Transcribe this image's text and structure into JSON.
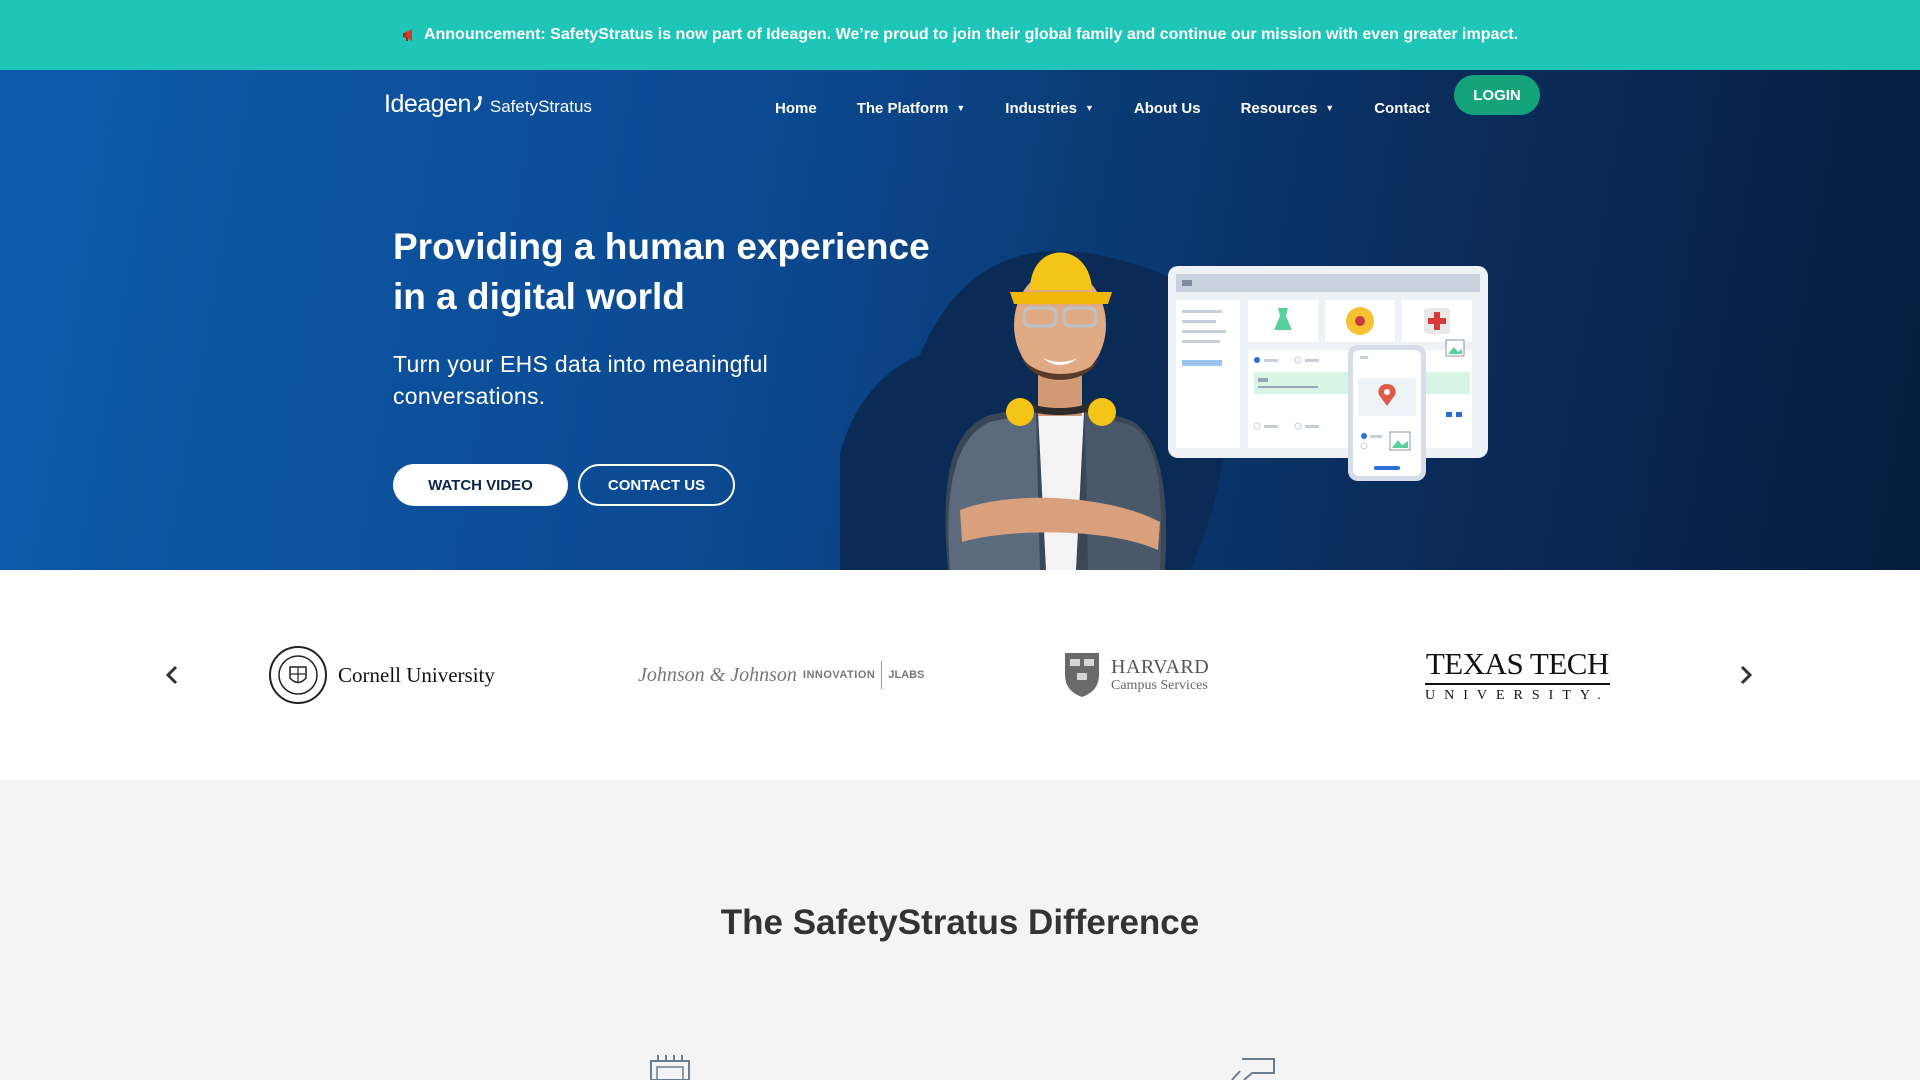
{
  "announcement": {
    "icon": "megaphone-icon",
    "text": "Announcement: SafetyStratus is now part of Ideagen. We’re proud to join their global family and continue our mission with even greater impact."
  },
  "header": {
    "logo_brand": "Ideagen",
    "logo_product": "SafetyStratus",
    "nav": [
      {
        "label": "Home",
        "dropdown": false
      },
      {
        "label": "The Platform",
        "dropdown": true
      },
      {
        "label": "Industries",
        "dropdown": true
      },
      {
        "label": "About Us",
        "dropdown": false
      },
      {
        "label": "Resources",
        "dropdown": true
      },
      {
        "label": "Contact",
        "dropdown": false
      }
    ],
    "login_label": "LOGIN"
  },
  "hero": {
    "title": "Providing a human experience in a digital world",
    "subtitle": "Turn your EHS data into meaningful conversations.",
    "watch_video_label": "WATCH VIDEO",
    "contact_label": "CONTACT US"
  },
  "clients": {
    "cornell": "Cornell University",
    "jnj_script": "Johnson & Johnson",
    "jnj_innovation": "INNOVATION",
    "jnj_jlabs": "JLABS",
    "harvard_name": "HARVARD",
    "harvard_sub": "Campus Services",
    "ttu_name": "TEXAS TECH",
    "ttu_sub": "UNIVERSITY."
  },
  "difference": {
    "title": "The SafetyStratus Difference"
  },
  "colors": {
    "announcement_bg": "#1fc5b7",
    "login_bg": "#14a37a",
    "hero_from": "#0d5aab",
    "hero_to": "#061c3e"
  }
}
